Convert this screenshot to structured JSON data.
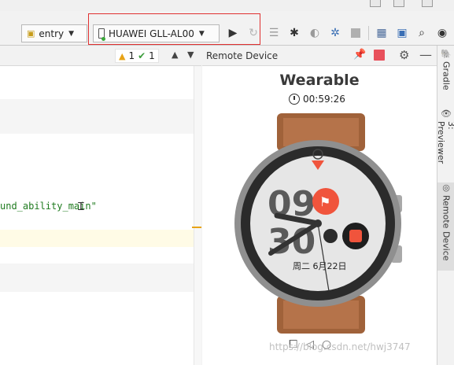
{
  "toolbar": {
    "module_selector": "entry",
    "device_selector": "HUAWEI GLL-AL00"
  },
  "editor": {
    "warning_count": "1",
    "ok_count": "1",
    "code_fragment": "und_ability_main\""
  },
  "remote_device": {
    "panel_title": "Remote Device",
    "device_name": "Wearable",
    "timer": "00:59:26",
    "watch_face": {
      "hour": "09",
      "minute": "30",
      "date": "周二 6月22日"
    },
    "watermark": "https://blog.csdn.net/hwj3747"
  },
  "side_tabs": {
    "gradle": "Gradle",
    "previewer": "3: Previewer",
    "remote_device": "Remote Device"
  },
  "colors": {
    "accent_red": "#e03030",
    "stop_red": "#e8505b",
    "watch_orange": "#f0543c"
  }
}
